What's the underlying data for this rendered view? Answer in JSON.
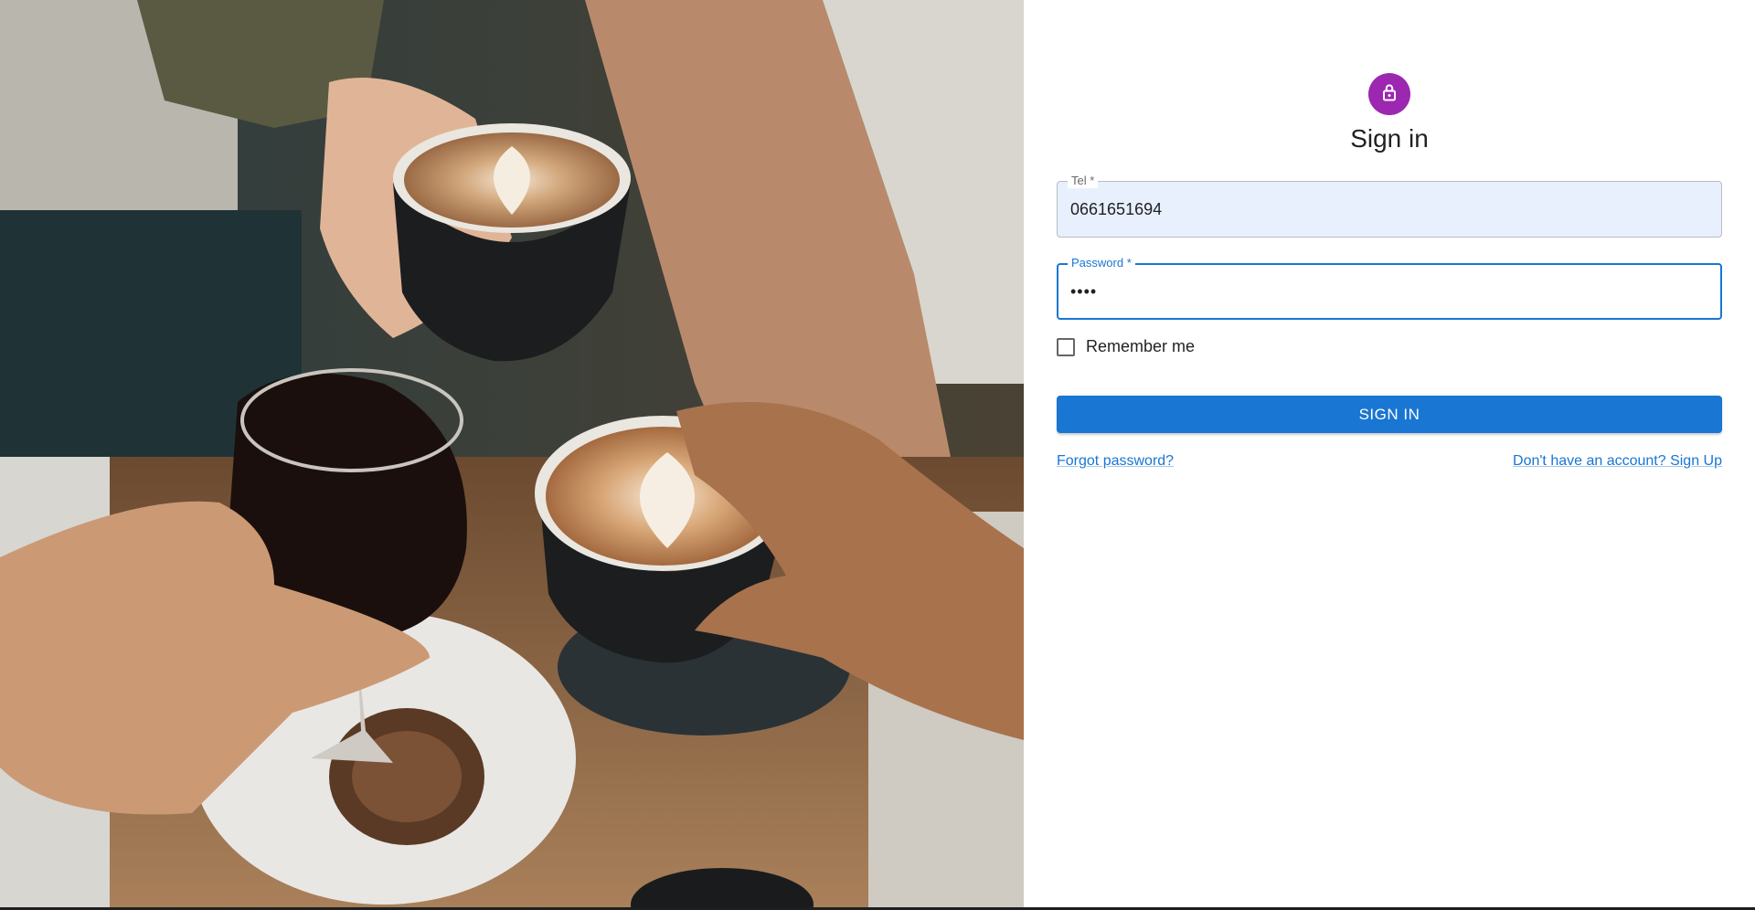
{
  "photo": {
    "description_icon": "coffee-cheers-photo"
  },
  "header": {
    "icon": "lock-icon",
    "title": "Sign in",
    "accent_color": "#9c27b0"
  },
  "form": {
    "tel": {
      "label": "Tel *",
      "value": "0661651694"
    },
    "password": {
      "label": "Password *",
      "value": "••••"
    },
    "remember_label": "Remember me",
    "submit_label": "SIGN IN",
    "primary_color": "#1976d2"
  },
  "links": {
    "forgot": "Forgot password?",
    "signup": "Don't have an account? Sign Up"
  }
}
